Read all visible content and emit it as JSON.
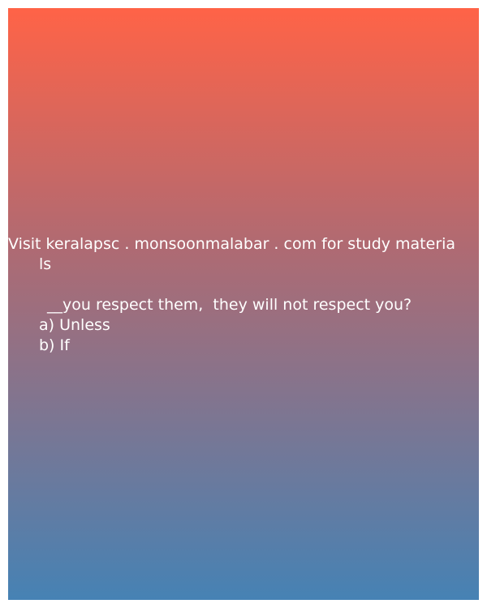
{
  "colors": {
    "gradient_top": "#ff6347",
    "gradient_bottom": "#4682b4",
    "text": "#ffffff"
  },
  "promo": {
    "line1": "Visit keralapsc . monsoonmalabar . com for study materia",
    "line2": "ls"
  },
  "question": {
    "text": "__you respect them,  they will not respect you?",
    "options": [
      {
        "label": "a) Unless"
      },
      {
        "label": "b) If"
      }
    ]
  }
}
